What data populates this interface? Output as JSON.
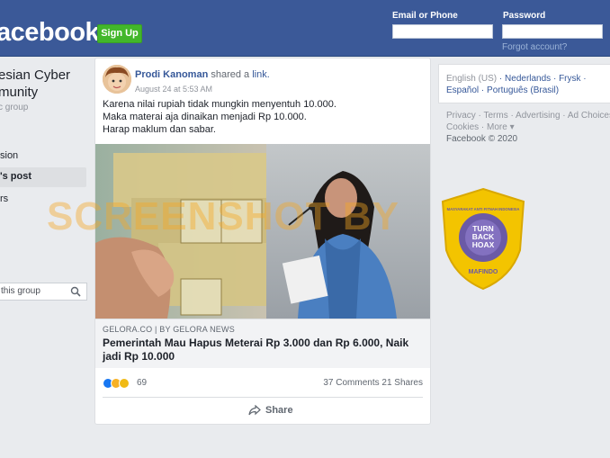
{
  "topbar": {
    "logo": "acebook",
    "signup_label": "Sign Up",
    "email_label": "Email or Phone",
    "password_label": "Password",
    "forgot_label": "Forgot account?"
  },
  "sidebar": {
    "group_title_line1": "esian Cyber",
    "group_title_line2": "munity",
    "group_type": "c group",
    "items": [
      {
        "label": "sion"
      },
      {
        "label": "'s post"
      },
      {
        "label": "rs"
      }
    ],
    "search_placeholder": "this group"
  },
  "post": {
    "author": "Prodi Kanoman",
    "action": " shared a ",
    "action_link": "link.",
    "timestamp": "August 24 at 5:53 AM",
    "text_lines": [
      "Karena nilai rupiah tidak mungkin menyentuh 10.000.",
      "Maka materai aja dinaikan menjadi Rp 10.000.",
      "Harap maklum dan sabar."
    ],
    "link_domain": "GELORA.CO | BY GELORA NEWS",
    "link_title": "Pemerintah Mau Hapus Meterai Rp 3.000 dan Rp 6.000, Naik jadi Rp 10.000",
    "reaction_count": "69",
    "comments": "37 Comments",
    "shares": "21 Shares",
    "share_label": "Share"
  },
  "watermark": "SCREENSHOT BY",
  "right": {
    "lang_current": "English (US)",
    "langs_row1": [
      "Nederlands",
      "Frysk"
    ],
    "langs_row2": [
      "Español",
      "Português (Brasil)"
    ],
    "footer_row1": "Privacy · Terms · Advertising · Ad Choices",
    "footer_row2": "Cookies · More ▾",
    "copyright": "Facebook © 2020"
  },
  "badge": {
    "top_text": "MASYARAKAT ANTI FITNAH INDONESIA",
    "line1": "TURN",
    "line2": "BACK",
    "line3": "HOAX",
    "bottom_text": "MAFINDO"
  },
  "colors": {
    "brand": "#3b5998",
    "signup": "#42b72a",
    "link": "#365899",
    "watermark": "#f5a623"
  }
}
